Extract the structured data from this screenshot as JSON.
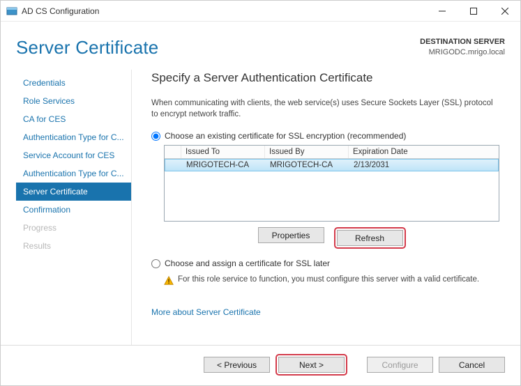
{
  "window": {
    "title": "AD CS Configuration"
  },
  "header": {
    "page_title": "Server Certificate",
    "dest_label": "DESTINATION SERVER",
    "dest_host": "MRIGODC.mrigo.local"
  },
  "sidebar": {
    "items": [
      {
        "label": "Credentials",
        "state": "normal"
      },
      {
        "label": "Role Services",
        "state": "normal"
      },
      {
        "label": "CA for CES",
        "state": "normal"
      },
      {
        "label": "Authentication Type for C...",
        "state": "normal"
      },
      {
        "label": "Service Account for CES",
        "state": "normal"
      },
      {
        "label": "Authentication Type for C...",
        "state": "normal"
      },
      {
        "label": "Server Certificate",
        "state": "selected"
      },
      {
        "label": "Confirmation",
        "state": "normal"
      },
      {
        "label": "Progress",
        "state": "disabled"
      },
      {
        "label": "Results",
        "state": "disabled"
      }
    ]
  },
  "content": {
    "heading": "Specify a Server Authentication Certificate",
    "description": "When communicating with clients, the web service(s) uses Secure Sockets Layer (SSL) protocol to encrypt network traffic.",
    "option_existing": "Choose an existing certificate for SSL encryption (recommended)",
    "option_later": "Choose and assign a certificate for SSL later",
    "grid": {
      "columns": {
        "c1": "Issued To",
        "c2": "Issued By",
        "c3": "Expiration Date"
      },
      "rows": [
        {
          "issued_to": "MRIGOTECH-CA",
          "issued_by": "MRIGOTECH-CA",
          "expiration": "2/13/2031"
        }
      ]
    },
    "buttons": {
      "properties": "Properties",
      "refresh": "Refresh"
    },
    "warning": "For this role service to function, you must configure this server with a valid certificate.",
    "more_link": "More about Server Certificate"
  },
  "footer": {
    "previous": "< Previous",
    "next": "Next >",
    "configure": "Configure",
    "cancel": "Cancel"
  }
}
